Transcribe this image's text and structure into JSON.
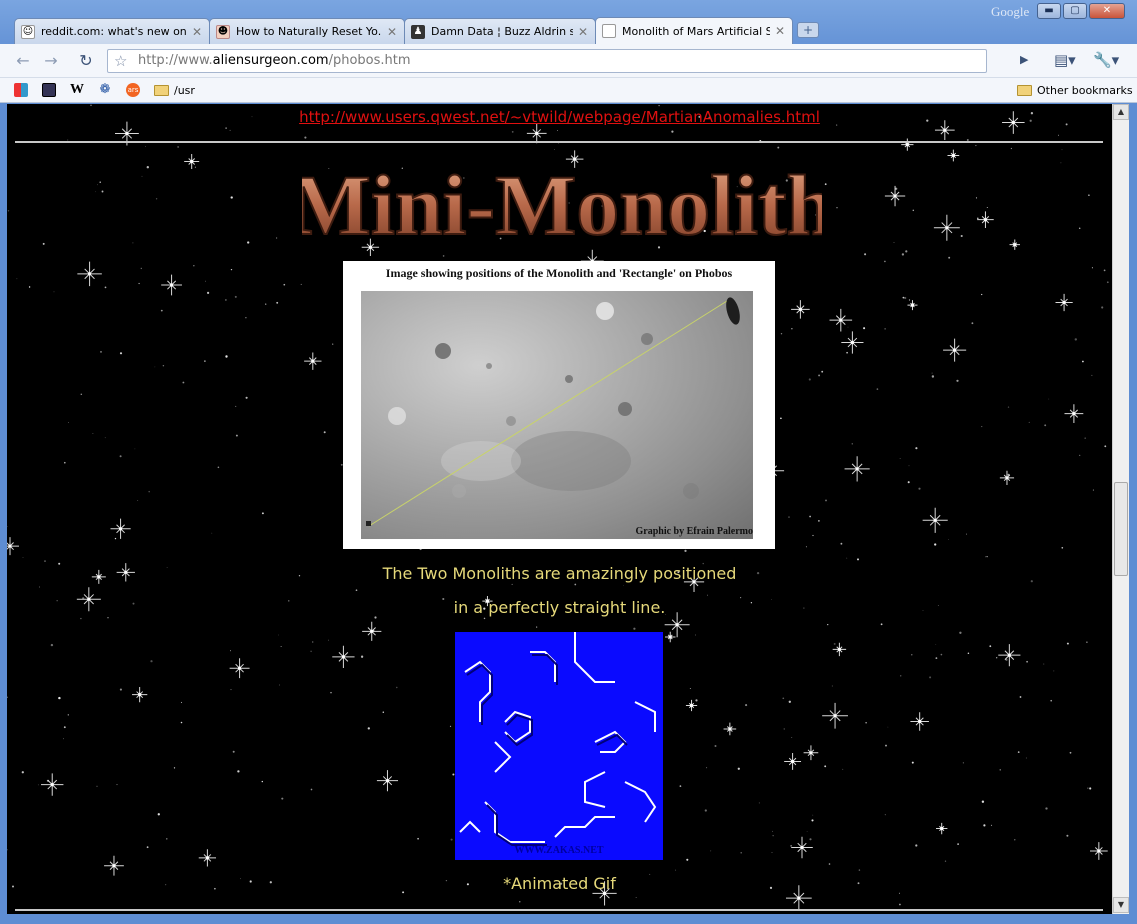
{
  "window": {
    "brand": "Google",
    "controls": {
      "minimize": "▬",
      "maximize": "▢",
      "close": "✕"
    }
  },
  "tabs": [
    {
      "label": "reddit.com: what's new onli...",
      "icon": "reddit-alien-icon",
      "active": false
    },
    {
      "label": "How to Naturally Reset Yo...",
      "icon": "face-icon",
      "active": false
    },
    {
      "label": "Damn Data ¦ Buzz Aldrin sa...",
      "icon": "portrait-icon",
      "active": false
    },
    {
      "label": "Monolith of Mars Artificial S...",
      "icon": "page-icon",
      "active": true
    }
  ],
  "newtab_label": "+",
  "omnibox": {
    "prefix": "http://www.",
    "domain": "aliensurgeon.com",
    "path": "/phobos.htm"
  },
  "bookmarks": {
    "items": [
      {
        "icon": "igoogle-icon",
        "label": ""
      },
      {
        "icon": "delicious-icon",
        "label": ""
      },
      {
        "icon": "wikipedia-icon",
        "label": "W"
      },
      {
        "icon": "paw-icon",
        "label": ""
      },
      {
        "icon": "ars-icon",
        "label": "ars"
      },
      {
        "icon": "folder-icon",
        "label": "/usr"
      }
    ],
    "other": "Other bookmarks"
  },
  "page": {
    "top_link": "http://www.users.qwest.net/~vtwild/webpage/MartianAnomalies.html",
    "logo_text": "Mini-Monolith",
    "image_caption": "Image showing positions of the Monolith and 'Rectangle' on Phobos",
    "image_credit": "Graphic by Efrain Palermo",
    "desc_line1": "The Two Monoliths are amazingly positioned",
    "desc_line2": "in a perfectly straight line.",
    "gif_watermark": "WWW.ZAKAS.NET",
    "gif_note": "*Animated Gif"
  },
  "colors": {
    "link": "#e01010",
    "desc_text": "#e6d97a",
    "gif_bg": "#0a0aff"
  }
}
